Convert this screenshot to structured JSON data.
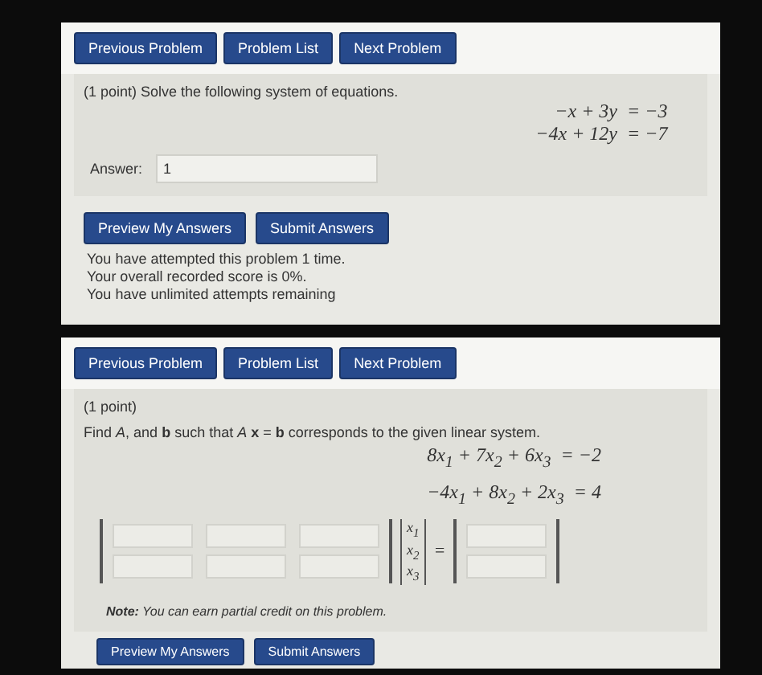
{
  "panels": [
    {
      "kind": "system",
      "nav": [
        "Previous Problem",
        "Problem List",
        "Next Problem"
      ],
      "intro": "(1 point) Solve the following system of equations.",
      "equations": [
        {
          "lhs": "−x + 3y",
          "rhs": "= −3"
        },
        {
          "lhs": "−4x + 12y",
          "rhs": "= −7"
        }
      ],
      "answer": {
        "label": "Answer:",
        "value": "1"
      },
      "actions": [
        "Preview My Answers",
        "Submit Answers"
      ],
      "messages": [
        "You have attempted this problem 1 time.",
        "Your overall recorded score is 0%.",
        "You have unlimited attempts remaining"
      ]
    },
    {
      "kind": "matrix",
      "nav": [
        "Previous Problem",
        "Problem List",
        "Next Problem"
      ],
      "intro": "(1 point)",
      "question": "Find *A*, and **b** such that *A* **x** = **b** corresponds to the given linear system.",
      "equations": [
        {
          "lhs": "8x$_{1}$ + 7x$_{2}$ + 6x$_{3}$",
          "rhs": "= −2"
        },
        {
          "lhs": "−4x$_{1}$ + 8x$_{2}$ + 2x$_{3}$",
          "rhs": "= 4"
        }
      ],
      "vector": [
        "x$_{1}$",
        "x$_{2}$",
        "x$_{3}$"
      ],
      "equals": "=",
      "note": "**Note:** You can earn partial credit on this problem.",
      "actions": [
        "Preview My Answers",
        "Submit Answers"
      ]
    }
  ]
}
